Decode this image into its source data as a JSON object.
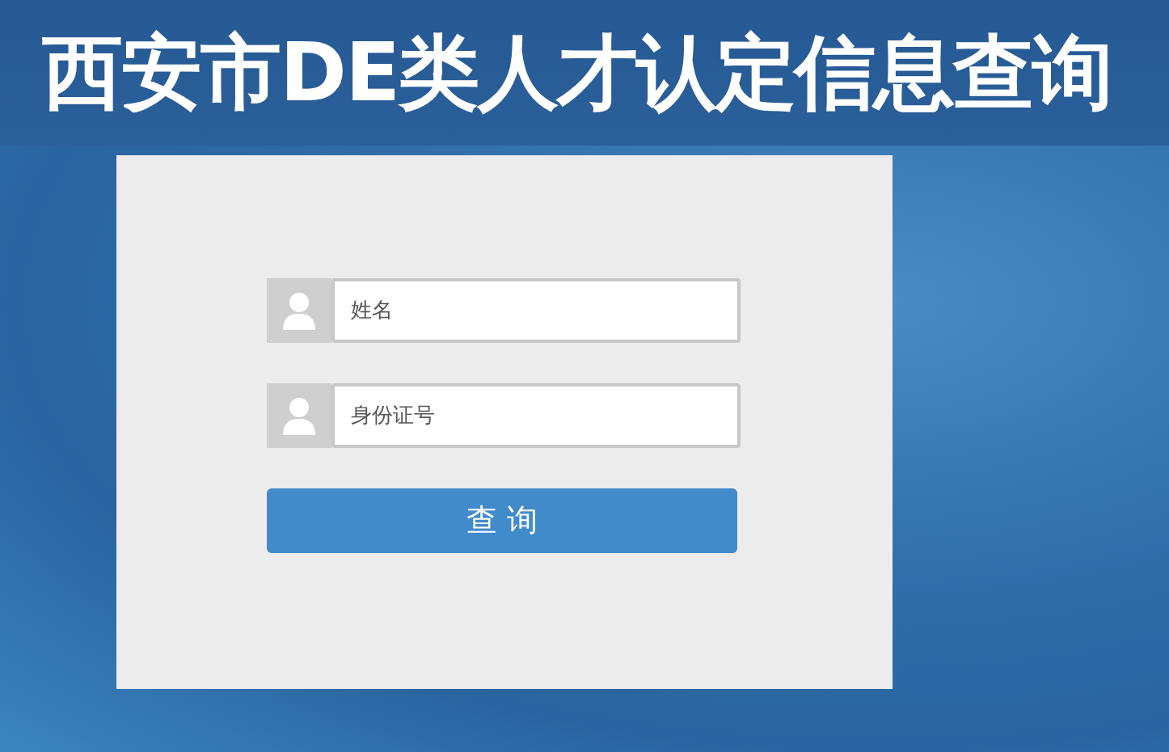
{
  "header": {
    "title": "西安市DE类人才认定信息查询"
  },
  "form": {
    "fields": [
      {
        "placeholder": "姓名"
      },
      {
        "placeholder": "身份证号"
      }
    ],
    "button": "查 询"
  }
}
